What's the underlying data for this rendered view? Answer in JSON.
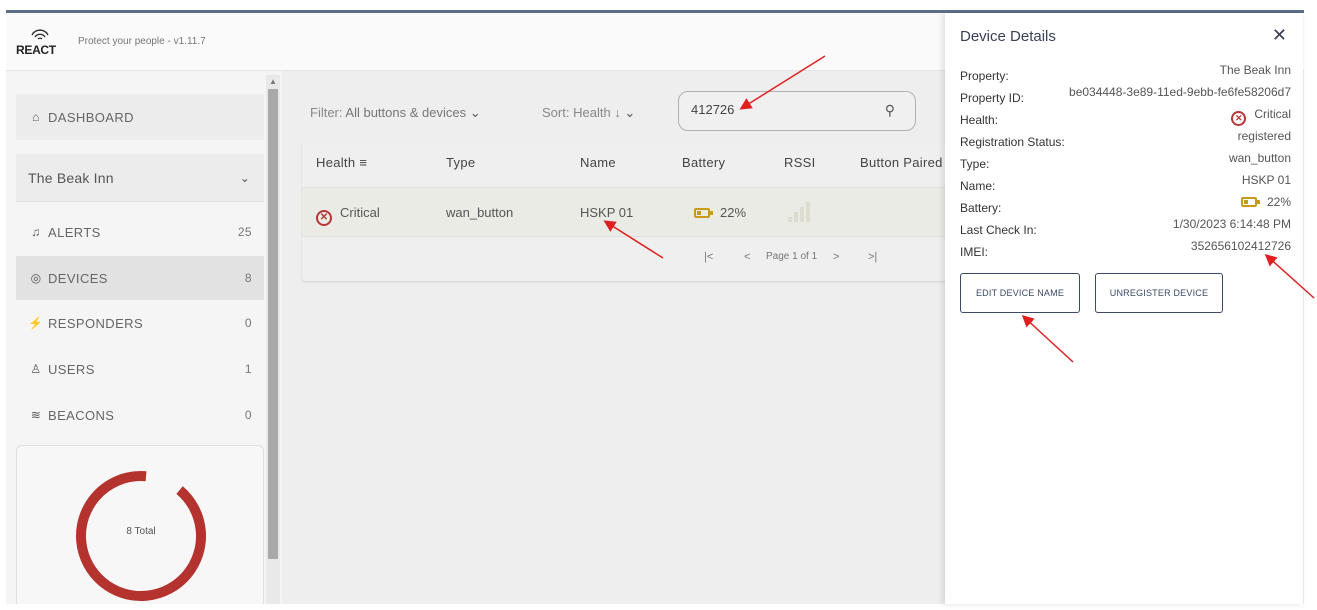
{
  "header": {
    "logo_text": "REACT",
    "tagline": "Protect your people - v1.11.7"
  },
  "sidebar": {
    "dashboard_label": "DASHBOARD",
    "property_name": "The Beak Inn",
    "items": [
      {
        "label": "ALERTS",
        "count": "25",
        "icon": "bell-icon"
      },
      {
        "label": "DEVICES",
        "count": "8",
        "icon": "device-icon"
      },
      {
        "label": "RESPONDERS",
        "count": "0",
        "icon": "runner-icon"
      },
      {
        "label": "USERS",
        "count": "1",
        "icon": "user-icon"
      },
      {
        "label": "BEACONS",
        "count": "0",
        "icon": "wifi-icon"
      }
    ],
    "donut": {
      "label": "8 Total",
      "color": "#b5332e"
    }
  },
  "toolbar": {
    "filter_label": "Filter:",
    "filter_value": "All buttons & devices",
    "sort_label": "Sort:",
    "sort_value": "Health ↓",
    "search_value": "412726"
  },
  "table": {
    "headers": {
      "health": "Health",
      "type": "Type",
      "name": "Name",
      "battery": "Battery",
      "rssi": "RSSI",
      "button_paired": "Button Paired"
    },
    "row": {
      "health": "Critical",
      "type": "wan_button",
      "name": "HSKP 01",
      "battery": "22%"
    },
    "pager": {
      "first": "|<",
      "prev": "<",
      "page": "Page 1 of 1",
      "next": ">",
      "last": ">|"
    }
  },
  "drawer": {
    "title": "Device Details",
    "fields": [
      {
        "k": "Property:",
        "v": "The Beak Inn"
      },
      {
        "k": "Property ID:",
        "v": "be034448-3e89-11ed-9ebb-fe6fe58206d7"
      },
      {
        "k": "Health:",
        "v": "Critical"
      },
      {
        "k": "Registration Status:",
        "v": "registered"
      },
      {
        "k": "Type:",
        "v": "wan_button"
      },
      {
        "k": "Name:",
        "v": "HSKP 01"
      },
      {
        "k": "Battery:",
        "v": "22%"
      },
      {
        "k": "Last Check In:",
        "v": "1/30/2023 6:14:48 PM"
      },
      {
        "k": "IMEI:",
        "v": "352656102412726"
      }
    ],
    "edit_button": "EDIT DEVICE NAME",
    "unregister_button": "UNREGISTER DEVICE"
  },
  "colors": {
    "critical": "#b73636",
    "battery": "#c99a1a",
    "accent": "#3a4a68",
    "annotation_arrow": "#e02020"
  }
}
